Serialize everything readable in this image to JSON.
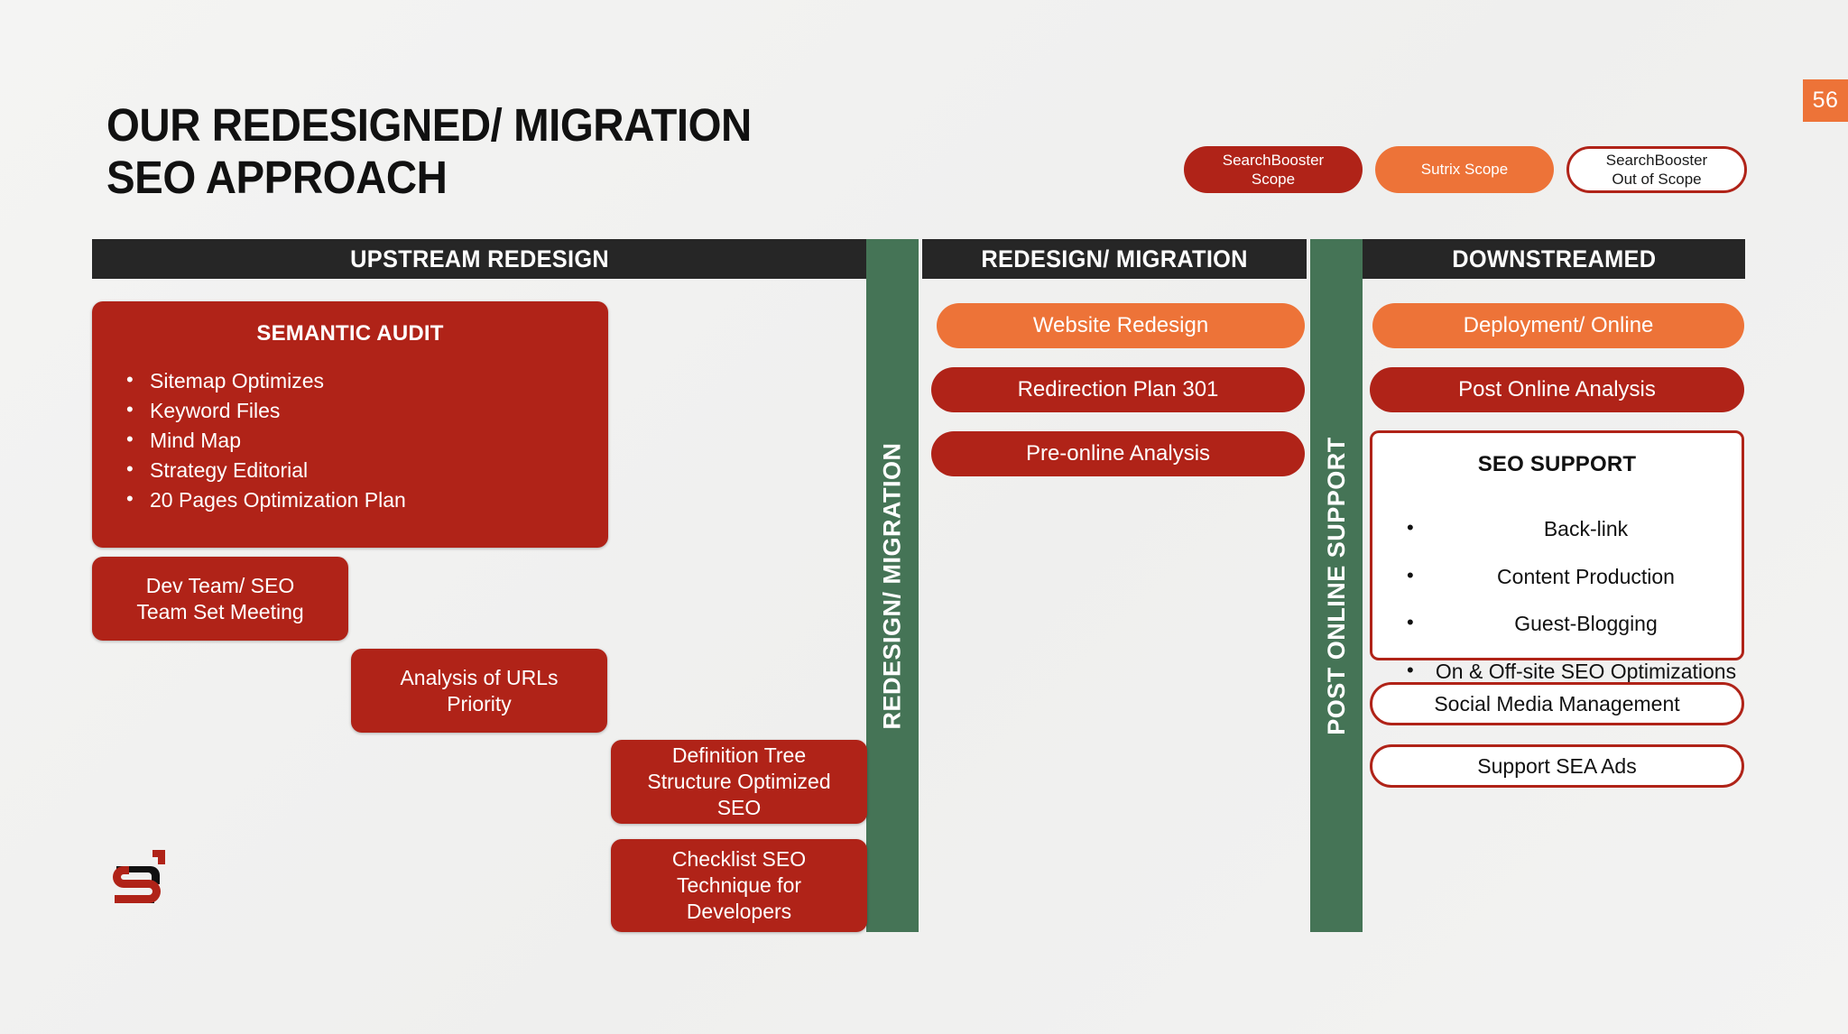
{
  "slide": {
    "page_number": "56",
    "title_lines": [
      "OUR REDESIGNED/ MIGRATION",
      "SEO APPROACH"
    ],
    "accent_red": "#b02318",
    "accent_orange": "#ed7338",
    "accent_green": "#457456",
    "header_dark": "#262626",
    "background": "#f2f2f0"
  },
  "legend": {
    "items": [
      {
        "label": "SearchBooster\nScope",
        "style": "solid-red"
      },
      {
        "label": "Sutrix Scope",
        "style": "solid-orange"
      },
      {
        "label": "SearchBooster\nOut of Scope",
        "style": "outline-red"
      }
    ]
  },
  "columns": {
    "upstream": {
      "header": "UPSTREAM REDESIGN"
    },
    "redesign": {
      "header": "REDESIGN/ MIGRATION"
    },
    "downstreamed": {
      "header": "DOWNSTREAMED"
    }
  },
  "bands": {
    "middle": "REDESIGN/ MIGRATION",
    "right": "POST ONLINE SUPPORT"
  },
  "upstream": {
    "semantic_audit": {
      "title": "SEMANTIC AUDIT",
      "bullets": [
        "Sitemap Optimizes",
        "Keyword Files",
        "Mind Map",
        "Strategy Editorial",
        "20 Pages Optimization Plan"
      ]
    },
    "dev_team": "Dev Team/ SEO\nTeam Set Meeting",
    "analysis_urls": "Analysis of URLs\nPriority",
    "definition_tree": "Definition Tree\nStructure Optimized\nSEO",
    "checklist_seo": "Checklist SEO\nTechnique for\nDevelopers"
  },
  "redesign_migration": {
    "website_redesign": "Website Redesign",
    "redirection_plan": "Redirection Plan 301",
    "pre_online_analysis": "Pre-online Analysis"
  },
  "downstreamed": {
    "deployment": "Deployment/ Online",
    "post_online_analysis": "Post Online Analysis",
    "seo_support": {
      "title": "SEO SUPPORT",
      "bullets": [
        "Back-link",
        "Content Production",
        "Guest-Blogging",
        "On & Off-site SEO Optimizations"
      ]
    },
    "social_media": "Social Media Management",
    "support_sea": "Support SEA Ads"
  }
}
